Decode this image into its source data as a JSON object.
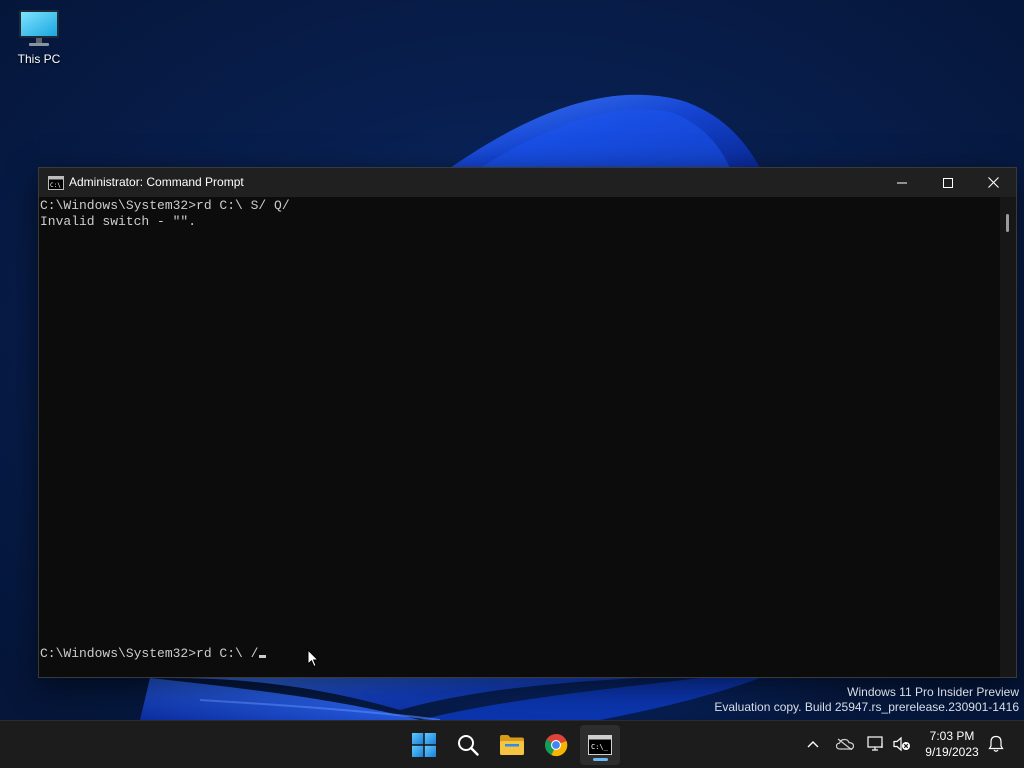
{
  "desktop": {
    "icons": [
      {
        "label": "This PC",
        "icon": "monitor-icon"
      }
    ],
    "watermark": {
      "line1": "Windows 11 Pro Insider Preview",
      "line2": "Evaluation copy. Build 25947.rs_prerelease.230901-1416"
    }
  },
  "window": {
    "title": "Administrator: Command Prompt",
    "icon": "console-icon",
    "controls": [
      "minimize-icon",
      "maximize-icon",
      "close-icon"
    ],
    "console": {
      "lines": [
        "C:\\Windows\\System32>rd C:\\ S/ Q/",
        "Invalid switch - \"\"."
      ],
      "prompt": "C:\\Windows\\System32>rd C:\\ /"
    }
  },
  "taskbar": {
    "apps": [
      "windows-start-icon",
      "search-icon",
      "file-explorer-icon",
      "chrome-icon",
      "command-prompt-icon"
    ],
    "active_app": "command-prompt-icon",
    "tray": [
      "chevron-up-icon",
      "onedrive-icon",
      "network-icon",
      "volume-muted-icon",
      "notification-bell-icon"
    ],
    "clock": {
      "time": "7:03 PM",
      "date": "9/19/2023"
    }
  },
  "colors": {
    "console_bg": "#0c0c0c",
    "console_text": "#cccccc",
    "title_bar": "#202020",
    "taskbar": "#1c1c1c",
    "accent": "#6cb8f0"
  }
}
